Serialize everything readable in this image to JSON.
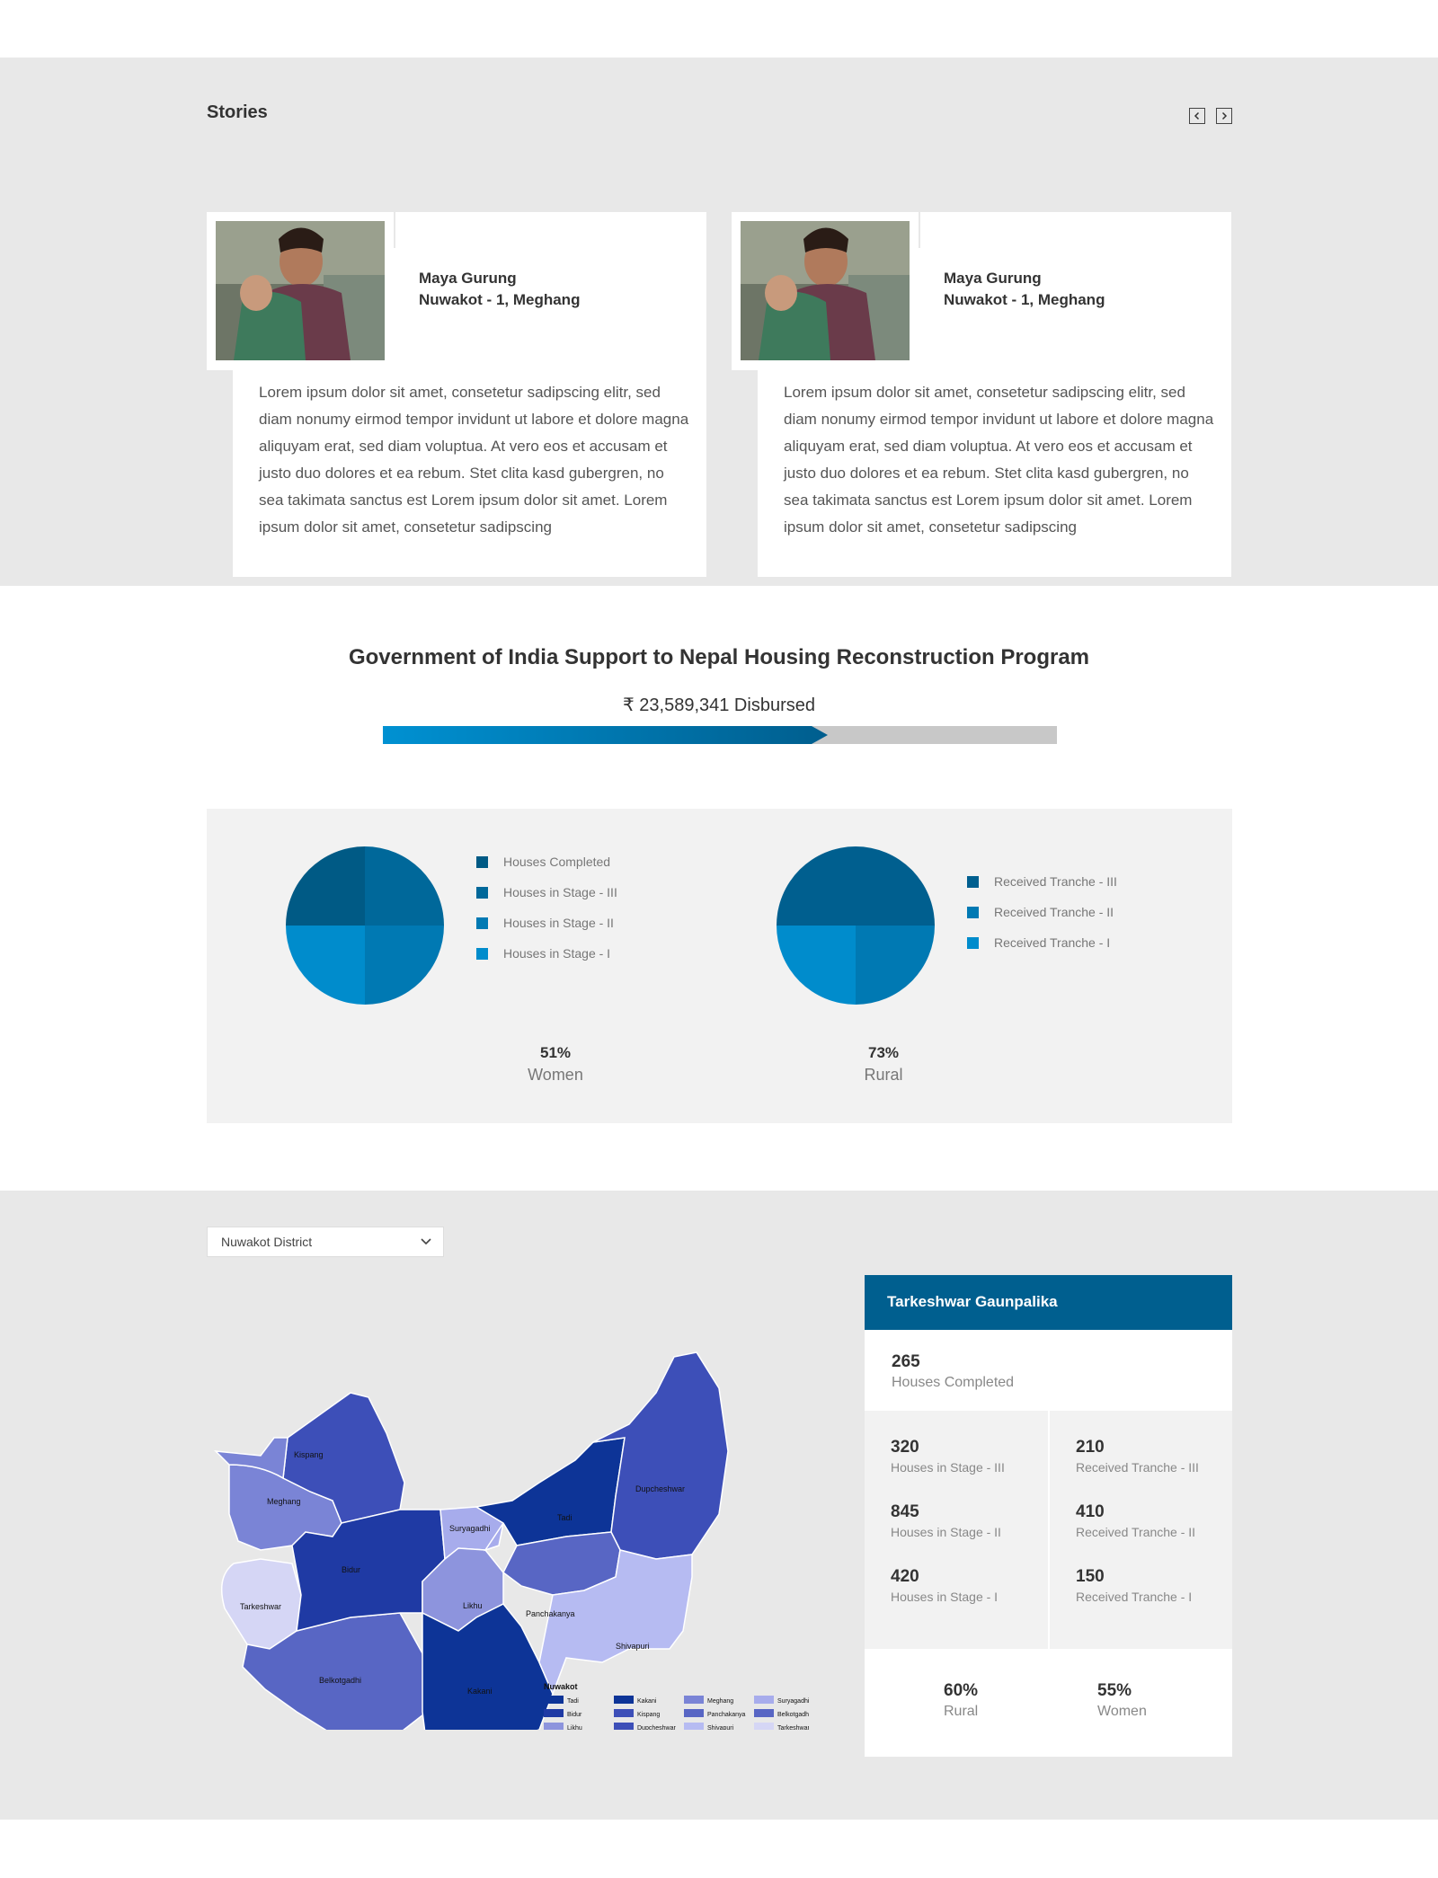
{
  "stories": {
    "title": "Stories",
    "prev_icon": "chevron-left-icon",
    "next_icon": "chevron-right-icon",
    "cards": [
      {
        "name": "Maya Gurung",
        "location": "Nuwakot - 1, Meghang",
        "text": "Lorem ipsum dolor sit amet, consetetur sadipscing elitr, sed diam nonumy eirmod tempor invidunt ut labore et dolore magna aliquyam erat, sed diam voluptua. At vero eos et accusam et justo duo dolores et ea rebum. Stet clita kasd gubergren, no sea takimata sanctus est Lorem ipsum dolor sit amet. Lorem ipsum dolor sit amet, consetetur sadipscing"
      },
      {
        "name": "Maya Gurung",
        "location": "Nuwakot - 1, Meghang",
        "text": "Lorem ipsum dolor sit amet, consetetur sadipscing elitr, sed diam nonumy eirmod tempor invidunt ut labore et dolore magna aliquyam erat, sed diam voluptua. At vero eos et accusam et justo duo dolores et ea rebum. Stet clita kasd gubergren, no sea takimata sanctus est Lorem ipsum dolor sit amet. Lorem ipsum dolor sit amet, consetetur sadipscing"
      }
    ]
  },
  "program": {
    "title": "Government of India Support to Nepal Housing Reconstruction Program",
    "disbursed": "₹ 23,589,341 Disbursed",
    "progress_fraction": 0.66
  },
  "charts": {
    "houses_legend": [
      "Houses Completed",
      "Houses in Stage - III",
      "Houses in Stage - II",
      "Houses in Stage - I"
    ],
    "tranche_legend": [
      "Received Tranche - III",
      "Received Tranche - II",
      "Received Tranche - I"
    ],
    "women": {
      "value": "51%",
      "label": "Women"
    },
    "rural": {
      "value": "73%",
      "label": "Rural"
    }
  },
  "chart_data": [
    {
      "type": "pie",
      "categories": [
        "Houses Completed",
        "Houses in Stage - III",
        "Houses in Stage - II",
        "Houses in Stage - I"
      ],
      "values": [
        25,
        25,
        25,
        25
      ],
      "colors": [
        "#005a85",
        "#00689a",
        "#0079b3",
        "#008ccc"
      ]
    },
    {
      "type": "pie",
      "categories": [
        "Received Tranche - III",
        "Received Tranche - II",
        "Received Tranche - I"
      ],
      "values": [
        50,
        25,
        25
      ],
      "colors": [
        "#005f8f",
        "#0079b3",
        "#008ccc"
      ]
    }
  ],
  "colors": {
    "accent": "#005f8f",
    "legend_houses": [
      "#005a85",
      "#00689a",
      "#0079b3",
      "#008ccc"
    ],
    "legend_tranche": [
      "#005f8f",
      "#0079b3",
      "#008ccc"
    ]
  },
  "map": {
    "district_select": "Nuwakot District",
    "select_icon": "chevron-down-icon",
    "regions": [
      "Kispang",
      "Meghang",
      "Bidur",
      "Tarkeshwar",
      "Belkotgadhi",
      "Suryagadhi",
      "Likhu",
      "Tadi",
      "Dupcheshwar",
      "Panchakanya",
      "Kakani",
      "Shivapuri"
    ],
    "legend_title": "Nuwakot",
    "legend_items": [
      "Tadi",
      "Bidur",
      "Likhu",
      "Kakani",
      "Kispang",
      "Dupcheshwar",
      "Meghang",
      "Panchakanya",
      "Shivapuri",
      "Suryagadhi",
      "Belkotgadhi",
      "Tarkeshwar"
    ]
  },
  "info": {
    "title": "Tarkeshwar Gaunpalika",
    "houses_completed": {
      "value": "265",
      "label": "Houses Completed"
    },
    "grid": [
      {
        "value": "320",
        "label": "Houses in Stage - III"
      },
      {
        "value": "210",
        "label": "Received Tranche - III"
      },
      {
        "value": "845",
        "label": "Houses in Stage - II"
      },
      {
        "value": "410",
        "label": "Received Tranche - II"
      },
      {
        "value": "420",
        "label": "Houses in Stage - I"
      },
      {
        "value": "150",
        "label": "Received Tranche - I"
      }
    ],
    "rural": {
      "value": "60%",
      "label": "Rural"
    },
    "women": {
      "value": "55%",
      "label": "Women"
    }
  }
}
